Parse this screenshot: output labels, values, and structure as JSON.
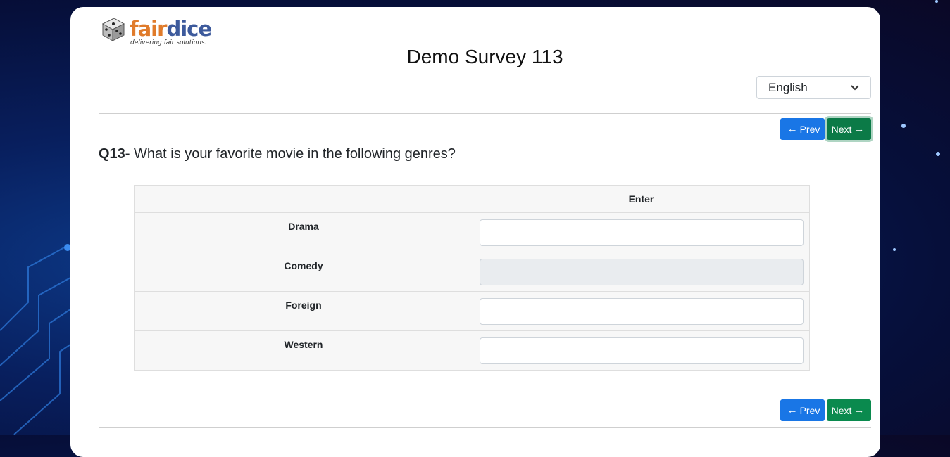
{
  "brand": {
    "name_part1": "fair",
    "name_part2": "dice",
    "tagline": "delivering fair solutions."
  },
  "survey": {
    "title": "Demo Survey 113"
  },
  "language": {
    "selected": "English"
  },
  "nav": {
    "prev_label": "Prev",
    "next_label": "Next"
  },
  "question": {
    "number": "Q13-",
    "text": " What is your favorite movie in the following genres?"
  },
  "grid": {
    "column_header": "Enter",
    "rows": [
      {
        "label": "Drama",
        "value": "",
        "disabled": false
      },
      {
        "label": "Comedy",
        "value": "",
        "disabled": true
      },
      {
        "label": "Foreign",
        "value": "",
        "disabled": false
      },
      {
        "label": "Western",
        "value": "",
        "disabled": false
      }
    ]
  },
  "colors": {
    "prev_button": "#1976e6",
    "next_button": "#0a8a4e",
    "logo_orange": "#e07b2b",
    "logo_blue": "#3d5a9c"
  }
}
